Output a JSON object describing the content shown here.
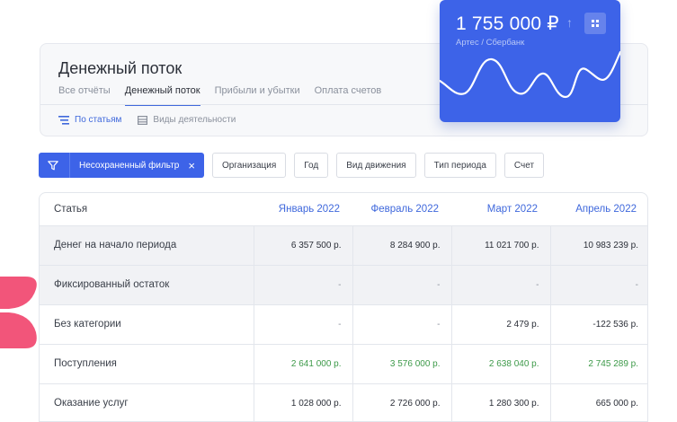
{
  "page": {
    "title": "Денежный поток",
    "tabs": [
      {
        "label": "Все отчёты",
        "active": false
      },
      {
        "label": "Денежный поток",
        "active": true
      },
      {
        "label": "Прибыли и убытки",
        "active": false
      },
      {
        "label": "Оплата счетов",
        "active": false
      }
    ],
    "subtabs": [
      {
        "label": "По статьям",
        "icon": "list-icon",
        "active": true
      },
      {
        "label": "Виды деятельности",
        "icon": "table-icon",
        "active": false
      }
    ]
  },
  "balance": {
    "amount": "1 755 000 ₽",
    "trend_icon": "arrow-up-icon",
    "subtitle": "Артес / Сбербанк",
    "menu_icon": "grid-icon"
  },
  "filters": {
    "active_filter": "Несохраненный фильтр",
    "filter_icon": "funnel-icon",
    "chips": [
      "Организация",
      "Год",
      "Вид движения",
      "Тип периода",
      "Счет"
    ]
  },
  "table": {
    "columns": [
      "Статья",
      "Январь 2022",
      "Февраль 2022",
      "Март 2022",
      "Апрель 2022"
    ],
    "rows": [
      {
        "name": "Денег на начало периода",
        "values": [
          "6 357 500 р.",
          "8 284 900 р.",
          "11 021 700 р.",
          "10 983 239 р."
        ],
        "style": "gray"
      },
      {
        "name": "Фиксированный остаток",
        "values": [
          "-",
          "-",
          "-",
          "-"
        ],
        "style": "gray"
      },
      {
        "name": "Без категории",
        "values": [
          "-",
          "-",
          "2 479 р.",
          "-122 536 р."
        ],
        "style": "normal"
      },
      {
        "name": "Поступления",
        "values": [
          "2 641 000 р.",
          "3 576 000 р.",
          "2 638 040 р.",
          "2 745 289 р."
        ],
        "style": "green"
      },
      {
        "name": "Оказание услуг",
        "values": [
          "1 028 000 р.",
          "2 726 000 р.",
          "1 280 300 р.",
          "665 000 р."
        ],
        "style": "normal"
      }
    ]
  },
  "colors": {
    "accent": "#3d63e8",
    "positive": "#3e9a4a",
    "decor_pink": "#f2557a"
  }
}
